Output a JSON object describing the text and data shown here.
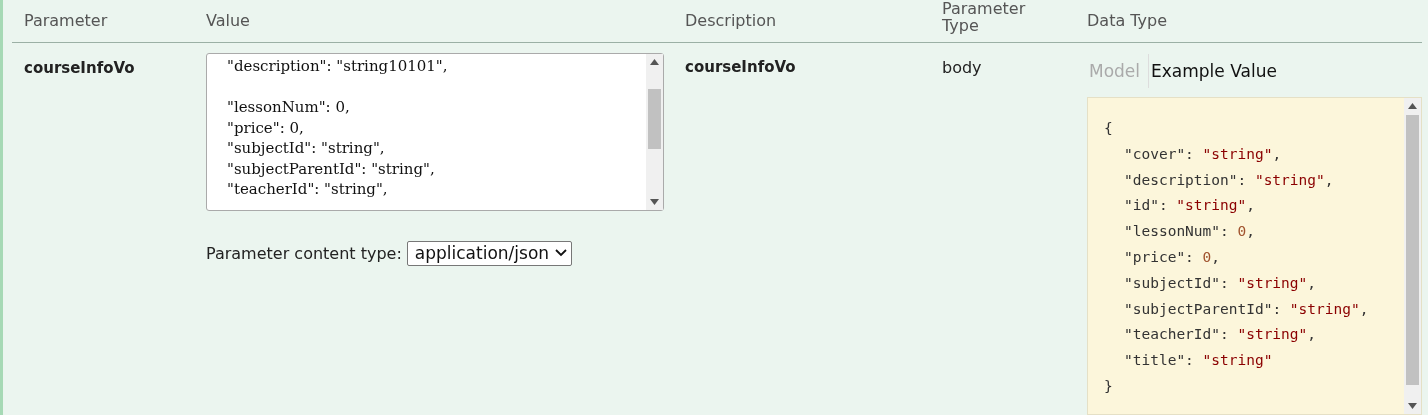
{
  "columns": [
    "Parameter",
    "Value",
    "Description",
    "Parameter\nType",
    "Data Type"
  ],
  "row": {
    "parameter": "courseInfoVo",
    "value_lines": [
      {
        "kind": "text",
        "text": "\"description\": \"string10101\","
      },
      {
        "kind": "blank"
      },
      {
        "kind": "text",
        "text": "\"lessonNum\": 0,"
      },
      {
        "kind": "text",
        "text": "\"price\": 0,"
      },
      {
        "kind": "text",
        "text": "\"subjectId\": \"string\","
      },
      {
        "kind": "text",
        "text": "\"subjectParentId\": \"string\","
      },
      {
        "kind": "text",
        "text": "\"teacherId\": \"string\","
      }
    ],
    "content_type_label": "Parameter content type:",
    "content_type": "application/json",
    "description": "courseInfoVo",
    "parameter_type": "body",
    "data_type_tabs": [
      {
        "label": "Model",
        "selected": false
      },
      {
        "label": "Example Value",
        "selected": true
      }
    ],
    "example_open": "{",
    "example_lines": [
      {
        "key": "\"cover\":",
        "value": "\"string\"",
        "kind": "string",
        "comma": ","
      },
      {
        "key": "\"description\":",
        "value": "\"string\"",
        "kind": "string",
        "comma": ","
      },
      {
        "key": "\"id\":",
        "value": "\"string\"",
        "kind": "string",
        "comma": ","
      },
      {
        "key": "\"lessonNum\":",
        "value": "0",
        "kind": "number",
        "comma": ","
      },
      {
        "key": "\"price\":",
        "value": "0",
        "kind": "number",
        "comma": ","
      },
      {
        "key": "\"subjectId\":",
        "value": "\"string\"",
        "kind": "string",
        "comma": ","
      },
      {
        "key": "\"subjectParentId\":",
        "value": "\"string\"",
        "kind": "string",
        "comma": ","
      },
      {
        "key": "\"teacherId\":",
        "value": "\"string\"",
        "kind": "string",
        "comma": ","
      },
      {
        "key": "\"title\":",
        "value": "\"string\"",
        "kind": "string"
      }
    ],
    "example_close": "}"
  }
}
